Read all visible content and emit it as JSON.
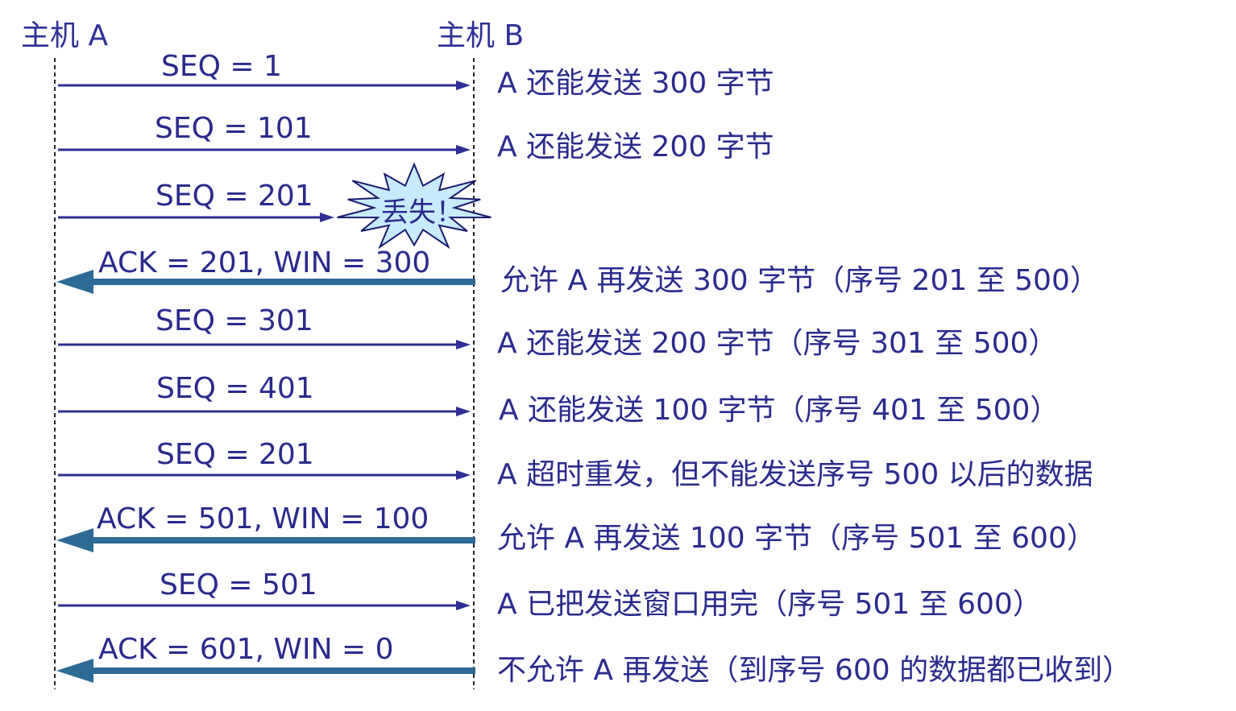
{
  "hosts": {
    "a": "主机 A",
    "b": "主机 B"
  },
  "messages": [
    {
      "label": "SEQ = 1",
      "direction": "A-to-B",
      "lost": false,
      "note": "A 还能发送 300 字节"
    },
    {
      "label": "SEQ = 101",
      "direction": "A-to-B",
      "lost": false,
      "note": "A 还能发送 200 字节"
    },
    {
      "label": "SEQ = 201",
      "direction": "A-to-B",
      "lost": true,
      "note": ""
    },
    {
      "label": "ACK = 201, WIN = 300",
      "direction": "B-to-A",
      "lost": false,
      "note": "允许 A 再发送 300 字节（序号 201 至 500）"
    },
    {
      "label": "SEQ = 301",
      "direction": "A-to-B",
      "lost": false,
      "note": "A 还能发送 200 字节（序号 301 至 500）"
    },
    {
      "label": "SEQ = 401",
      "direction": "A-to-B",
      "lost": false,
      "note": "A 还能发送 100 字节（序号 401 至 500）"
    },
    {
      "label": "SEQ = 201",
      "direction": "A-to-B",
      "lost": false,
      "note": "A 超时重发，但不能发送序号 500 以后的数据"
    },
    {
      "label": "ACK = 501, WIN = 100",
      "direction": "B-to-A",
      "lost": false,
      "note": "允许 A 再发送 100 字节（序号 501 至 600）"
    },
    {
      "label": "SEQ = 501",
      "direction": "A-to-B",
      "lost": false,
      "note": "A 已把发送窗口用完（序号 501 至 600）"
    },
    {
      "label": "ACK = 601, WIN = 0",
      "direction": "B-to-A",
      "lost": false,
      "note": "不允许 A 再发送（到序号 600 的数据都已收到）"
    }
  ],
  "lost_marker": {
    "text": "丢失！"
  },
  "colors": {
    "seq_arrow": "#2e2e96",
    "ack_arrow": "#2d6a96",
    "text": "#2b2b8e",
    "burst_fill": "#c6ebfa",
    "burst_stroke": "#1a1a6e"
  }
}
